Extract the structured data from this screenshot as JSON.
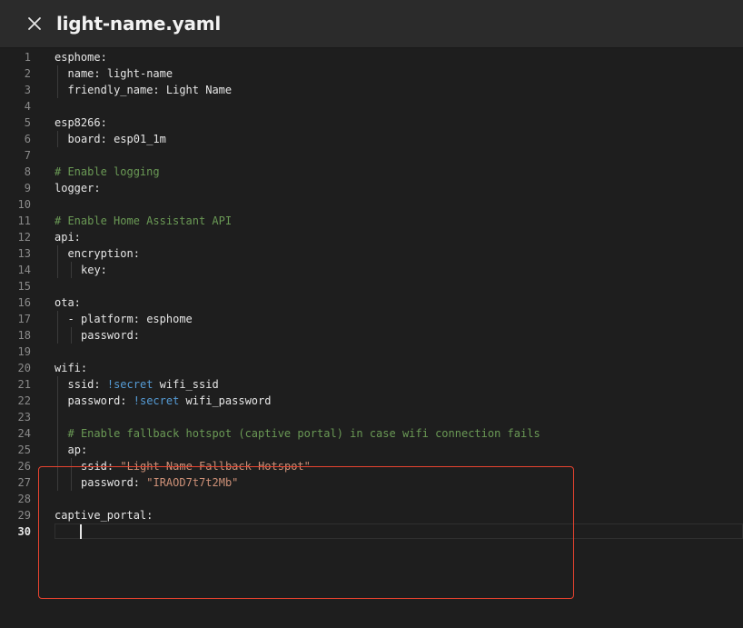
{
  "header": {
    "title": "light-name.yaml",
    "close_icon": "close-icon"
  },
  "colors": {
    "background": "#1e1e1e",
    "header": "#2b2b2b",
    "comment": "#6a9955",
    "tag": "#569cd6",
    "string": "#ce9178",
    "highlight": "#e8432f"
  },
  "editor": {
    "active_line": 30,
    "lines": [
      {
        "num": "1",
        "indent": 0,
        "parts": [
          {
            "t": "esphome:",
            "c": ""
          }
        ]
      },
      {
        "num": "2",
        "indent": 1,
        "parts": [
          {
            "t": "name: light-name",
            "c": ""
          }
        ]
      },
      {
        "num": "3",
        "indent": 1,
        "parts": [
          {
            "t": "friendly_name: Light Name",
            "c": ""
          }
        ]
      },
      {
        "num": "4",
        "indent": 0,
        "parts": []
      },
      {
        "num": "5",
        "indent": 0,
        "parts": [
          {
            "t": "esp8266:",
            "c": ""
          }
        ]
      },
      {
        "num": "6",
        "indent": 1,
        "parts": [
          {
            "t": "board: esp01_1m",
            "c": ""
          }
        ]
      },
      {
        "num": "7",
        "indent": 0,
        "parts": []
      },
      {
        "num": "8",
        "indent": 0,
        "comment": true,
        "parts": [
          {
            "t": "# Enable logging",
            "c": ""
          }
        ]
      },
      {
        "num": "9",
        "indent": 0,
        "parts": [
          {
            "t": "logger:",
            "c": ""
          }
        ]
      },
      {
        "num": "10",
        "indent": 0,
        "parts": []
      },
      {
        "num": "11",
        "indent": 0,
        "comment": true,
        "parts": [
          {
            "t": "# Enable Home Assistant API",
            "c": ""
          }
        ]
      },
      {
        "num": "12",
        "indent": 0,
        "parts": [
          {
            "t": "api:",
            "c": ""
          }
        ]
      },
      {
        "num": "13",
        "indent": 1,
        "parts": [
          {
            "t": "encryption:",
            "c": ""
          }
        ]
      },
      {
        "num": "14",
        "indent": 2,
        "parts": [
          {
            "t": "key:",
            "c": ""
          }
        ]
      },
      {
        "num": "15",
        "indent": 0,
        "parts": []
      },
      {
        "num": "16",
        "indent": 0,
        "parts": [
          {
            "t": "ota:",
            "c": ""
          }
        ]
      },
      {
        "num": "17",
        "indent": 1,
        "parts": [
          {
            "t": "- platform: esphome",
            "c": ""
          }
        ]
      },
      {
        "num": "18",
        "indent": 2,
        "parts": [
          {
            "t": "password:",
            "c": ""
          }
        ]
      },
      {
        "num": "19",
        "indent": 0,
        "parts": []
      },
      {
        "num": "20",
        "indent": 0,
        "parts": [
          {
            "t": "wifi:",
            "c": ""
          }
        ]
      },
      {
        "num": "21",
        "indent": 1,
        "parts": [
          {
            "t": "ssid: ",
            "c": ""
          },
          {
            "t": "!secret",
            "c": "tag"
          },
          {
            "t": " wifi_ssid",
            "c": ""
          }
        ]
      },
      {
        "num": "22",
        "indent": 1,
        "parts": [
          {
            "t": "password: ",
            "c": ""
          },
          {
            "t": "!secret",
            "c": "tag"
          },
          {
            "t": " wifi_password",
            "c": ""
          }
        ]
      },
      {
        "num": "23",
        "indent": 1,
        "parts": []
      },
      {
        "num": "24",
        "indent": 1,
        "comment": true,
        "parts": [
          {
            "t": "# Enable fallback hotspot (captive portal) in case wifi connection fails",
            "c": ""
          }
        ]
      },
      {
        "num": "25",
        "indent": 1,
        "parts": [
          {
            "t": "ap:",
            "c": ""
          }
        ]
      },
      {
        "num": "26",
        "indent": 2,
        "parts": [
          {
            "t": "ssid: ",
            "c": ""
          },
          {
            "t": "\"Light-Name Fallback Hotspot\"",
            "c": "str"
          }
        ]
      },
      {
        "num": "27",
        "indent": 2,
        "parts": [
          {
            "t": "password: ",
            "c": ""
          },
          {
            "t": "\"IRAOD7t7t2Mb\"",
            "c": "str"
          }
        ]
      },
      {
        "num": "28",
        "indent": 0,
        "parts": []
      },
      {
        "num": "29",
        "indent": 0,
        "parts": [
          {
            "t": "captive_portal:",
            "c": ""
          }
        ]
      },
      {
        "num": "30",
        "indent": 0,
        "parts": []
      }
    ]
  }
}
